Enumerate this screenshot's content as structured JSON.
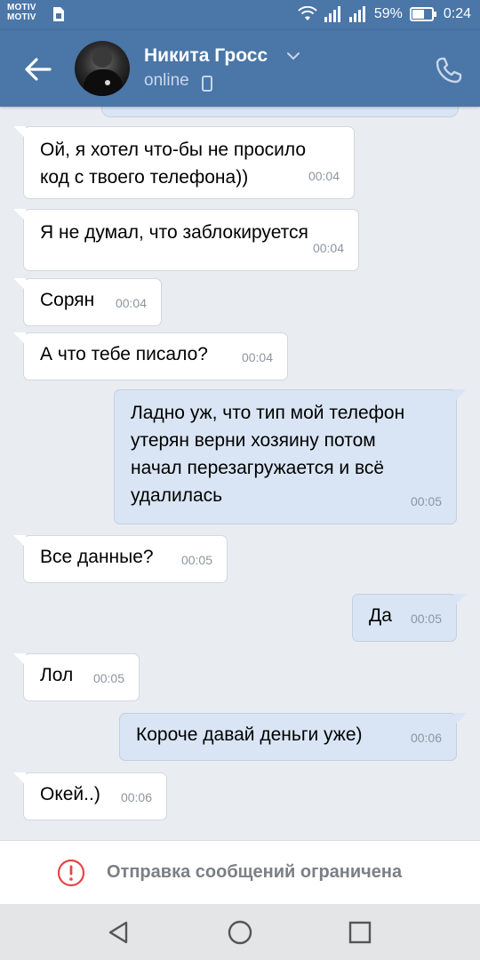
{
  "status_bar": {
    "carrier_1": "MOTIV",
    "carrier_2": "MOTIV",
    "battery": "59%",
    "time": "0:24",
    "icons": [
      "sim-icon",
      "wifi-icon",
      "signal-icon",
      "signal-icon",
      "battery-icon"
    ]
  },
  "header": {
    "contact_name": "Никита Гросс",
    "status": "online",
    "icons": [
      "back-arrow-icon",
      "chevron-down-icon",
      "mobile-phone-icon",
      "phone-call-icon"
    ]
  },
  "messages": [
    {
      "dir": "in",
      "text": "Ой, я хотел что-бы не просило\nкод с твоего телефона))",
      "time": "00:04"
    },
    {
      "dir": "in",
      "text": "Я не думал, что заблокируется",
      "time": "00:04"
    },
    {
      "dir": "in",
      "text": "Сорян",
      "time": "00:04"
    },
    {
      "dir": "in",
      "text": "А что тебе писало?",
      "time": "00:04"
    },
    {
      "dir": "out",
      "text": "Ладно уж, что тип мой телефон\nутерян верни хозяину потом\nначал перезагружается и всё\nудалилась",
      "time": "00:05"
    },
    {
      "dir": "in",
      "text": "Все данные?",
      "time": "00:05"
    },
    {
      "dir": "out",
      "text": "Да",
      "time": "00:05"
    },
    {
      "dir": "in",
      "text": "Лол",
      "time": "00:05"
    },
    {
      "dir": "out",
      "text": "Короче давай деньги уже)",
      "time": "00:06"
    },
    {
      "dir": "in",
      "text": "Окей..)",
      "time": "00:06"
    }
  ],
  "restriction": {
    "text": "Отправка сообщений ограничена",
    "icon": "warning-circle-icon",
    "icon_color": "#e64646"
  },
  "nav_bar": {
    "icons": [
      "back-triangle-icon",
      "home-circle-icon",
      "recents-square-icon"
    ]
  },
  "colors": {
    "header": "#4a76a8",
    "outgoing_bubble": "#d9e5f4",
    "incoming_bubble": "#ffffff",
    "chat_background": "#e9ecf1"
  }
}
